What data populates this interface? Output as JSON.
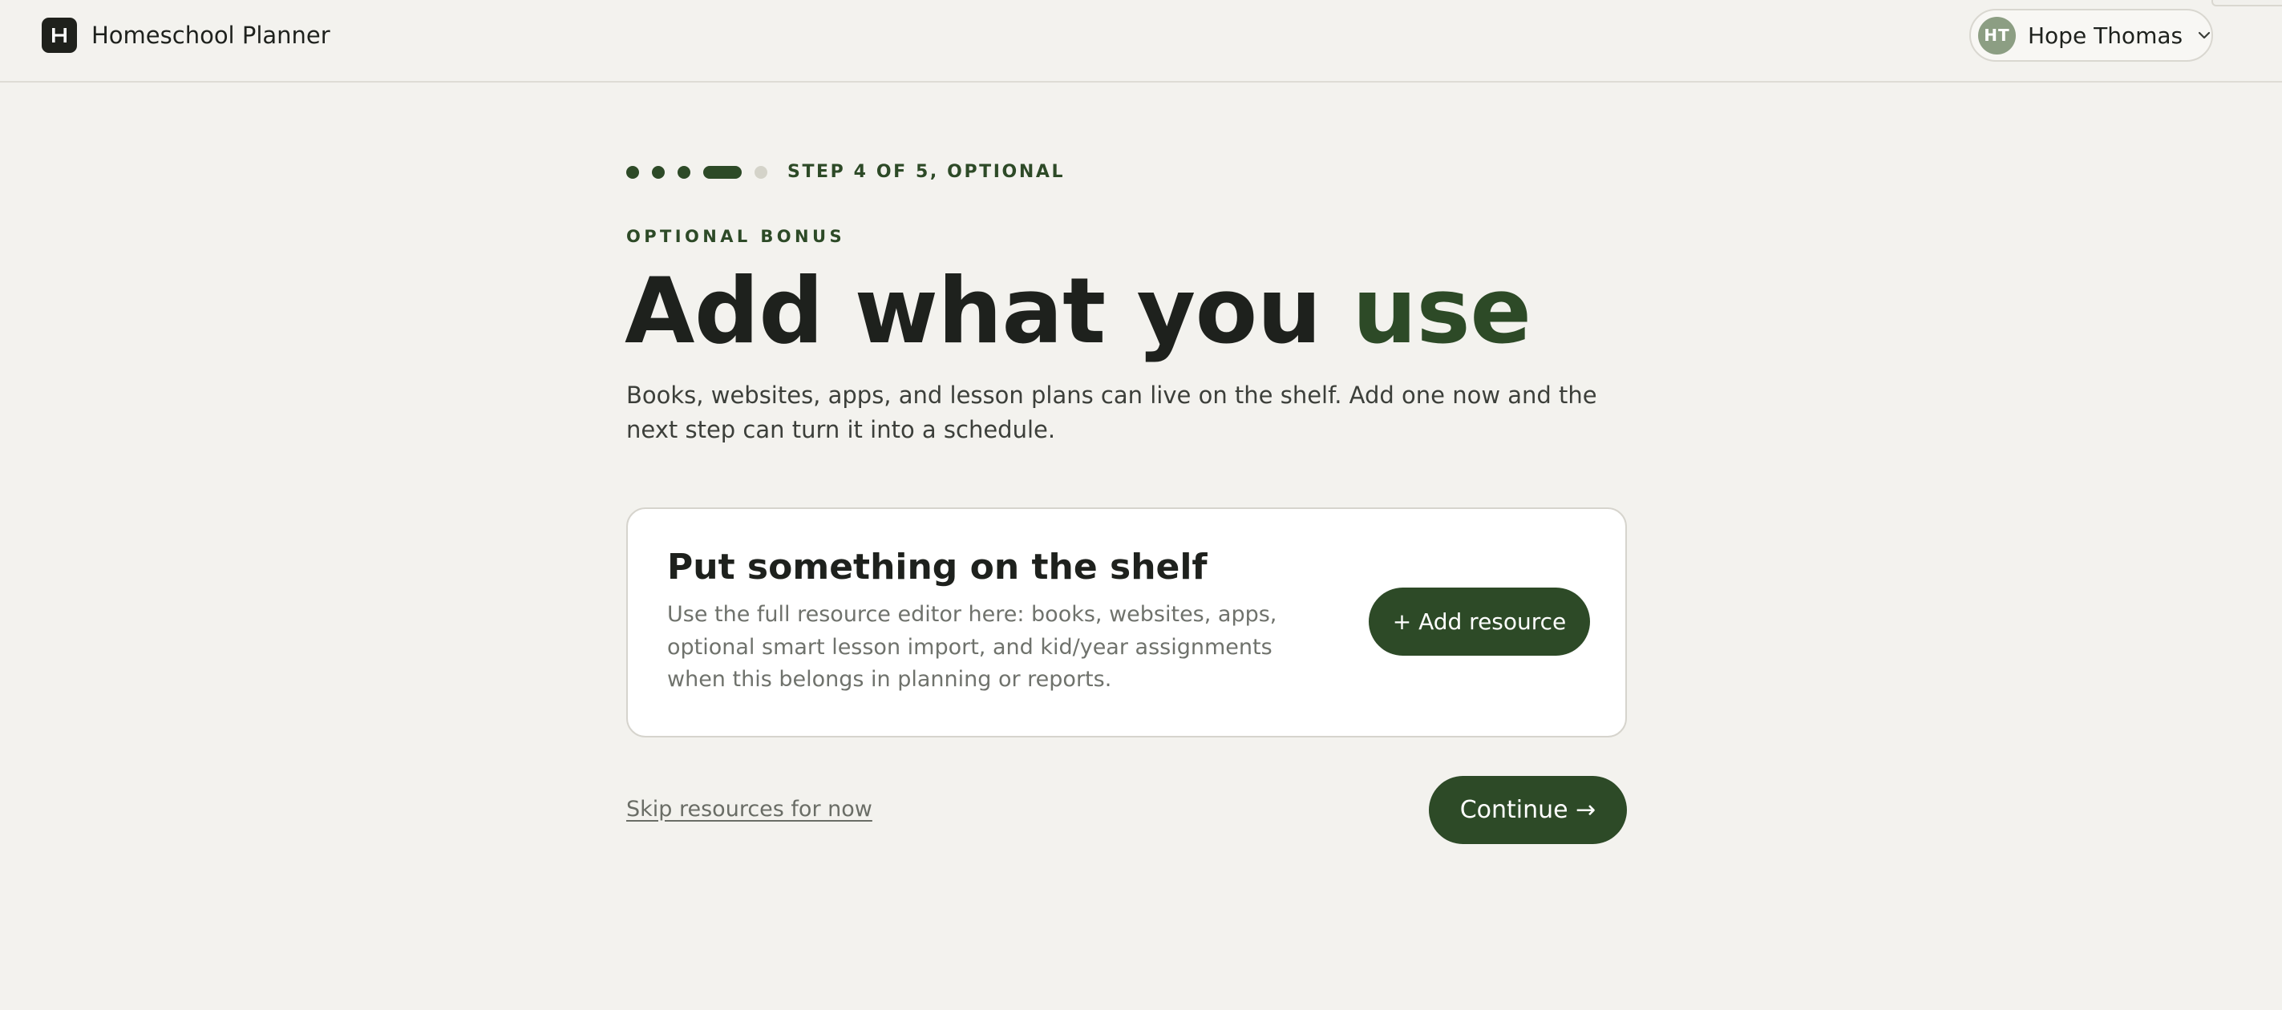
{
  "app": {
    "title": "Homeschool Planner",
    "logo_letter": "H"
  },
  "account": {
    "initials": "HT",
    "name": "Hope Thomas",
    "menu_icon": "chevron-down-icon"
  },
  "progress": {
    "current_step": 4,
    "total_steps": 5,
    "label": "STEP 4 OF 5, OPTIONAL"
  },
  "intro": {
    "eyebrow": "OPTIONAL BONUS",
    "headline_main": "Add what you ",
    "headline_accent": "use",
    "lede": "Books, websites, apps, and lesson plans can live on the shelf. Add one now and the next step can turn it into a schedule."
  },
  "card": {
    "title": "Put something on the shelf",
    "body": "Use the full resource editor here: books, websites, apps, optional smart lesson import, and kid/year assignments when this belongs in planning or reports.",
    "add_button_label": "+ Add resource"
  },
  "actions": {
    "skip_label": "Skip resources for now",
    "continue_label": "Continue →"
  },
  "colors": {
    "accent": "#2d4a27",
    "background": "#f3f2ee",
    "avatar": "#8c9e83",
    "progress_todo": "#d4d3c9"
  }
}
